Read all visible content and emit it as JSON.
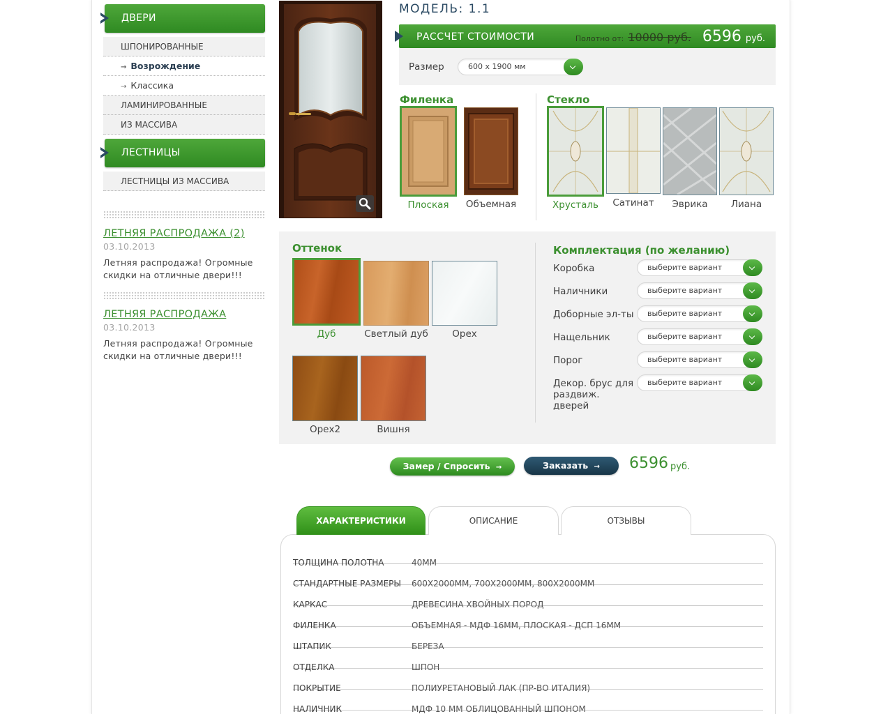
{
  "sidebar": {
    "categories": [
      {
        "title": "ДВЕРИ"
      },
      {
        "title": "ЛЕСТНИЦЫ"
      }
    ],
    "doors_items": [
      "ШПОНИРОВАННЫЕ",
      "Возрождение",
      "Классика",
      "ЛАМИНИРОВАННЫЕ",
      "ИЗ МАССИВА"
    ],
    "stairs_items": [
      "ЛЕСТНИЦЫ ИЗ МАССИВА"
    ],
    "news": [
      {
        "title": "ЛЕТНЯЯ РАСПРОДАЖА (2)",
        "date": "03.10.2013",
        "text": "Летняя распродажа! Огромные скидки на отличные двери!!!"
      },
      {
        "title": "ЛЕТНЯЯ РАСПРОДАЖА",
        "date": "03.10.2013",
        "text": "Летняя распродажа! Огромные скидки на отличные двери!!!"
      }
    ]
  },
  "product": {
    "model": "МОДЕЛЬ: 1.1",
    "calc_title": "РАССЧЕТ СТОИМОСТИ",
    "price_from_label": "Полотно от:",
    "old_price": "10000 руб.",
    "new_price": "6596",
    "currency": "руб.",
    "size_label": "Размер",
    "size_value": "600 x 1900 мм"
  },
  "panel": {
    "title": "Филенка",
    "options": [
      "Плоская",
      "Объемная"
    ],
    "selected": 0
  },
  "glass": {
    "title": "Стекло",
    "options": [
      "Хрусталь",
      "Сатинат",
      "Эврика",
      "Лиана"
    ],
    "selected": 0
  },
  "shade": {
    "title": "Оттенок",
    "options": [
      "Дуб",
      "Светлый дуб",
      "Орех",
      "Орех2",
      "Вишня"
    ],
    "selected": 0,
    "colors": [
      "#b8581f",
      "#d69a5a",
      "#f3f6f6",
      "#9a5a1e",
      "#c4602e"
    ]
  },
  "kit": {
    "title": "Комплектация (по желанию)",
    "placeholder": "выберите вариант",
    "rows": [
      "Коробка",
      "Наличники",
      "Доборные эл-ты",
      "Нащельник",
      "Порог",
      "Декор. брус для раздвиж. дверей"
    ]
  },
  "order": {
    "measure_label": "Замер / Спросить",
    "order_label": "Заказать",
    "arrow": "→",
    "total": "6596",
    "currency": "руб."
  },
  "tabs": [
    "ХАРАКТЕРИСТИКИ",
    "ОПИСАНИЕ",
    "ОТЗЫВЫ"
  ],
  "specs": [
    {
      "k": "ТОЛЩИНА ПОЛОТНА",
      "v": "40мм"
    },
    {
      "k": "СТАНДАРТНЫЕ РАЗМЕРЫ",
      "v": "600х2000мм, 700х2000мм, 800х2000мм"
    },
    {
      "k": "КАРКАС",
      "v": "древесина хвойных пород"
    },
    {
      "k": "ФИЛЕНКА",
      "v": "объемная - МДФ 16мм, плоская - ДСП 16мм"
    },
    {
      "k": "ШТАПИК",
      "v": "береза"
    },
    {
      "k": "ОТДЕЛКА",
      "v": "шпон"
    },
    {
      "k": "ПОКРЫТИЕ",
      "v": "полиуретановый лак (пр-во Италия)"
    },
    {
      "k": "НАЛИЧНИК",
      "v": "МДФ 10 мм облицованный шпоном"
    }
  ],
  "colors": {
    "accent_green": "#3c9030",
    "navy": "#2b4a63",
    "panel_bg": "#f2f2f2"
  }
}
